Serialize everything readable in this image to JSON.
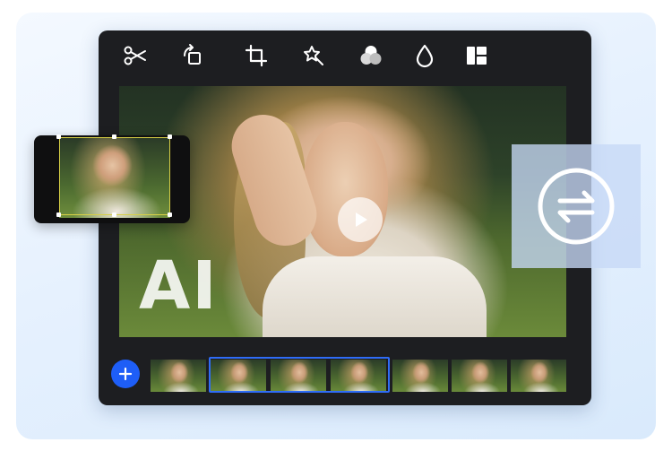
{
  "toolbar": {
    "tools": [
      {
        "name": "cut",
        "icon": "scissors-icon"
      },
      {
        "name": "rotate",
        "icon": "rotate-icon"
      },
      {
        "name": "crop",
        "icon": "crop-icon"
      },
      {
        "name": "ai-enhance",
        "icon": "magic-wand-icon"
      },
      {
        "name": "color",
        "icon": "color-circles-icon"
      },
      {
        "name": "adjust",
        "icon": "droplet-icon"
      },
      {
        "name": "layout",
        "icon": "layout-icon"
      }
    ]
  },
  "preview": {
    "overlay_text": "AI",
    "play_icon": "play-icon"
  },
  "filmstrip": {
    "add_icon": "plus-icon",
    "thumbnail_count": 7,
    "selected_range": [
      2,
      4
    ]
  },
  "compare": {
    "icon": "swap-arrows-icon"
  },
  "colors": {
    "accent": "#1e5ef7",
    "selection": "#2f6cf6",
    "editor_bg": "#1d1e21",
    "crop_frame": "#d8d046"
  }
}
